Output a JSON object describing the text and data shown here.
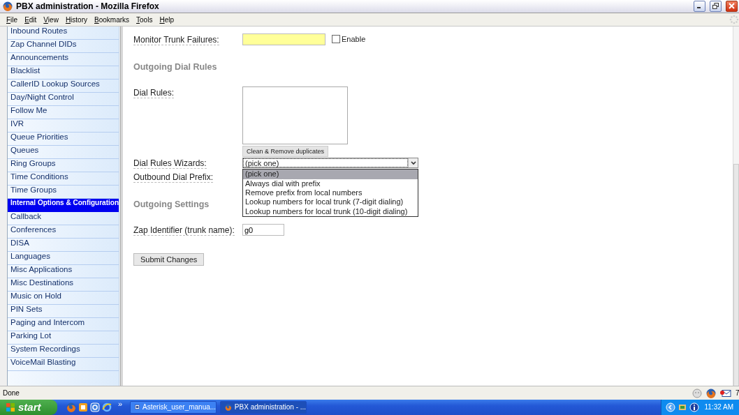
{
  "window": {
    "title": "PBX administration - Mozilla Firefox"
  },
  "menu": [
    "File",
    "Edit",
    "View",
    "History",
    "Bookmarks",
    "Tools",
    "Help"
  ],
  "sidebar": {
    "items": [
      {
        "label": "Inbound Routes",
        "selected": false
      },
      {
        "label": "Zap Channel DIDs",
        "selected": false
      },
      {
        "label": "Announcements",
        "selected": false
      },
      {
        "label": "Blacklist",
        "selected": false
      },
      {
        "label": "CallerID Lookup Sources",
        "selected": false
      },
      {
        "label": "Day/Night Control",
        "selected": false
      },
      {
        "label": "Follow Me",
        "selected": false
      },
      {
        "label": "IVR",
        "selected": false
      },
      {
        "label": "Queue Priorities",
        "selected": false
      },
      {
        "label": "Queues",
        "selected": false
      },
      {
        "label": "Ring Groups",
        "selected": false
      },
      {
        "label": "Time Conditions",
        "selected": false
      },
      {
        "label": "Time Groups",
        "selected": false
      },
      {
        "label": "Internal Options & Configuration",
        "selected": true
      },
      {
        "label": "Callback",
        "selected": false
      },
      {
        "label": "Conferences",
        "selected": false
      },
      {
        "label": "DISA",
        "selected": false
      },
      {
        "label": "Languages",
        "selected": false
      },
      {
        "label": "Misc Applications",
        "selected": false
      },
      {
        "label": "Misc Destinations",
        "selected": false
      },
      {
        "label": "Music on Hold",
        "selected": false
      },
      {
        "label": "PIN Sets",
        "selected": false
      },
      {
        "label": "Paging and Intercom",
        "selected": false
      },
      {
        "label": "Parking Lot",
        "selected": false
      },
      {
        "label": "System Recordings",
        "selected": false
      },
      {
        "label": "VoiceMail Blasting",
        "selected": false
      }
    ]
  },
  "form": {
    "rows": [
      {
        "kind": "field",
        "label": "Monitor Trunk Failures:",
        "field": {
          "kind": "input",
          "highlighted": true
        },
        "checkbox": {
          "label": "Enable",
          "checked": false
        }
      },
      {
        "kind": "heading",
        "label": "Outgoing Dial Rules"
      },
      {
        "kind": "field",
        "label": "Dial Rules:",
        "field": {
          "kind": "textarea"
        },
        "button": "Clean & Remove duplicates"
      },
      {
        "kind": "field",
        "label": "Dial Rules Wizards:",
        "field": {
          "kind": "select",
          "value": "(pick one)",
          "expanded": true,
          "options": [
            {
              "label": "(pick one)",
              "selected": true
            },
            {
              "label": "Always dial with prefix",
              "selected": false
            },
            {
              "label": "Remove prefix from local numbers",
              "selected": false
            },
            {
              "label": "Lookup numbers for local trunk (7-digit dialing)",
              "selected": false
            },
            {
              "label": "Lookup numbers for local trunk (10-digit dialing)",
              "selected": false
            }
          ]
        }
      },
      {
        "kind": "field",
        "label": "Outbound Dial Prefix:"
      },
      {
        "kind": "heading",
        "label": "Outgoing Settings"
      },
      {
        "kind": "field",
        "label": "Zap Identifier (trunk name):",
        "field": {
          "kind": "input",
          "value": "g0",
          "highlighted": false
        }
      }
    ],
    "submit": "Submit Changes"
  },
  "status_bar": {
    "text": "Done",
    "mail_count": "7"
  },
  "taskbar": {
    "start": "start",
    "more": "»",
    "tasks": [
      {
        "label": "Asterisk_user_manua...",
        "kind": "document",
        "selected": false
      },
      {
        "label": "PBX administration - ...",
        "kind": "browser",
        "selected": true
      }
    ],
    "clock": "11:32 AM"
  }
}
